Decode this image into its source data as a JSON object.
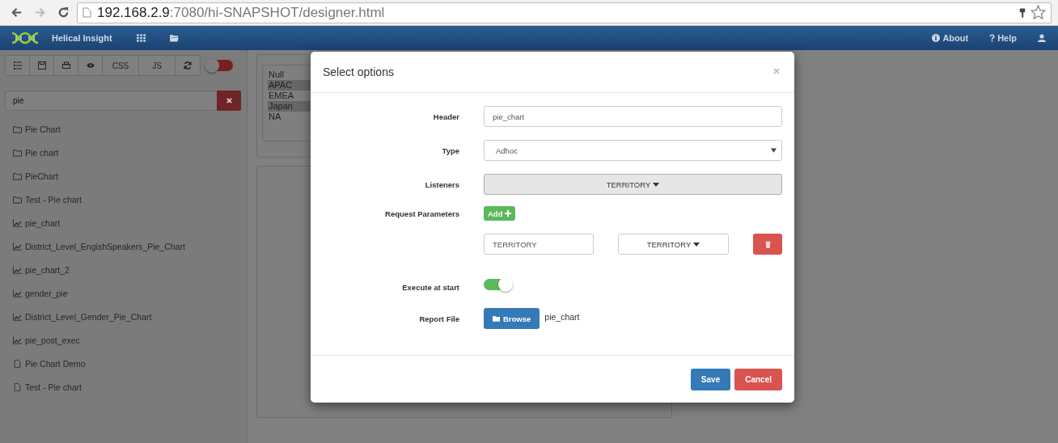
{
  "browser": {
    "url_host": "192.168.2.9",
    "url_rest": ":7080/hi-SNAPSHOT/designer.html"
  },
  "navbar": {
    "brand": "Helical Insight",
    "links": [
      {
        "kind": "info",
        "label": "About"
      },
      {
        "kind": "help",
        "label": "Help"
      }
    ]
  },
  "toolbar": {
    "buttons": [
      {
        "kind": "list"
      },
      {
        "kind": "save"
      },
      {
        "kind": "print"
      },
      {
        "kind": "eye"
      },
      {
        "kind": "text",
        "label": "CSS"
      },
      {
        "kind": "text",
        "label": "JS"
      },
      {
        "kind": "refresh"
      }
    ],
    "toggle_on": false
  },
  "search": {
    "value": "pie"
  },
  "files": [
    {
      "kind": "folder",
      "label": "Pie Chart"
    },
    {
      "kind": "folder",
      "label": "Pie chart"
    },
    {
      "kind": "folder",
      "label": "PieChart"
    },
    {
      "kind": "folder",
      "label": "Test - Pie chart"
    },
    {
      "kind": "chart",
      "label": "pie_chart"
    },
    {
      "kind": "chart",
      "label": "District_Level_EngishSpeakers_Pie_Chart"
    },
    {
      "kind": "chart",
      "label": "pie_chart_2"
    },
    {
      "kind": "chart",
      "label": "gender_pie"
    },
    {
      "kind": "chart",
      "label": "District_Level_Gender_Pie_Chart"
    },
    {
      "kind": "chart",
      "label": "pie_post_exec"
    },
    {
      "kind": "file",
      "label": "Pie Chart Demo"
    },
    {
      "kind": "file",
      "label": "Test - Pie chart"
    }
  ],
  "filter_list": [
    {
      "label": "Null",
      "selected": false
    },
    {
      "label": "APAC",
      "selected": true
    },
    {
      "label": "EMEA",
      "selected": false
    },
    {
      "label": "Japan",
      "selected": true
    },
    {
      "label": "NA",
      "selected": false
    }
  ],
  "modal": {
    "title": "Select options",
    "header": {
      "label": "Header",
      "value": "pie_chart"
    },
    "type": {
      "label": "Type",
      "value": "Adhoc"
    },
    "listeners": {
      "label": "Listeners",
      "value": "TERRITORY"
    },
    "request_parameters": {
      "label": "Request Parameters",
      "add_button": "Add",
      "params": [
        {
          "name": "TERRITORY",
          "value": "TERRITORY"
        }
      ]
    },
    "execute_at_start": {
      "label": "Execute at start",
      "on": true
    },
    "report_file": {
      "label": "Report File",
      "button": "Browse",
      "file": "pie_chart"
    },
    "buttons": [
      {
        "kind": "primary",
        "label": "Save"
      },
      {
        "kind": "danger",
        "label": "Cancel"
      }
    ]
  }
}
